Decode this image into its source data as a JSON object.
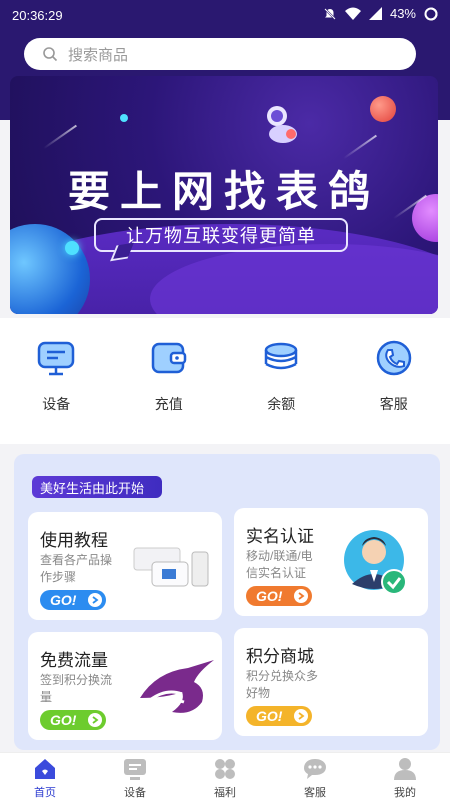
{
  "status_bar": {
    "time": "20:36:29",
    "battery": "43%"
  },
  "search": {
    "placeholder": "搜索商品"
  },
  "banner": {
    "headline": "要上网找表鸽",
    "slogan": "让万物互联变得更简单"
  },
  "quick_actions": [
    {
      "label": "设备",
      "icon": "monitor-icon"
    },
    {
      "label": "充值",
      "icon": "wallet-icon"
    },
    {
      "label": "余额",
      "icon": "coins-icon"
    },
    {
      "label": "客服",
      "icon": "phone-icon"
    }
  ],
  "promo": {
    "tag": "美好生活由此开始",
    "cards": [
      {
        "title": "使用教程",
        "desc": "查看各产品操作步骤",
        "go": "GO!",
        "color": "#2c8cf0"
      },
      {
        "title": "实名认证",
        "desc": "移动/联通/电信实名认证",
        "go": "GO!",
        "color": "#f07a2f"
      },
      {
        "title": "免费流量",
        "desc": "签到积分换流量",
        "go": "GO!",
        "color": "#6dcc2e"
      },
      {
        "title": "积分商城",
        "desc": "积分兑换众多好物",
        "go": "GO!",
        "color": "#f4b42a"
      }
    ]
  },
  "tabbar": [
    {
      "label": "首页",
      "icon": "home-icon",
      "active": true
    },
    {
      "label": "设备",
      "icon": "device-icon"
    },
    {
      "label": "福利",
      "icon": "grid-icon"
    },
    {
      "label": "客服",
      "icon": "chat-icon"
    },
    {
      "label": "我的",
      "icon": "user-icon"
    }
  ],
  "colors": {
    "brand_purple": "#2a1870",
    "active_tab": "#2c3bd0",
    "accent_blue": "#2c8cf0"
  }
}
